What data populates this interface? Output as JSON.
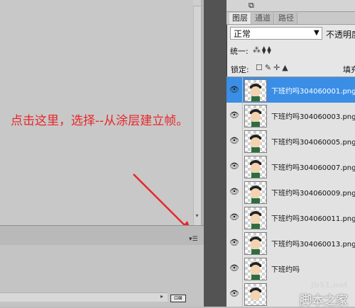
{
  "canvas": {
    "annotation": "点击这里，选择--从涂层建立帧。",
    "frames_icon": "⊡⊠"
  },
  "panel": {
    "tabs": [
      "图层",
      "通道",
      "路径"
    ],
    "blend_mode": "正常",
    "opacity_label": "不透明度",
    "unify_label": "统一:",
    "lock_label": "锁定:",
    "fill_label": "填充"
  },
  "layers": [
    {
      "name": "下班约吗304060001.png",
      "selected": true
    },
    {
      "name": "下班约吗304060003.png",
      "selected": false
    },
    {
      "name": "下班约吗304060005.png",
      "selected": false
    },
    {
      "name": "下班约吗304060007.png",
      "selected": false
    },
    {
      "name": "下班约吗304060009.png",
      "selected": false
    },
    {
      "name": "下班约吗304060011.png",
      "selected": false
    },
    {
      "name": "下班约吗304060013.png",
      "selected": false
    },
    {
      "name": "下班约吗",
      "selected": false
    }
  ],
  "watermark": {
    "url": "jb51.net",
    "text": "脚本之家"
  },
  "colors": {
    "annotation": "#e8262a",
    "selection": "#3a8ee6"
  }
}
